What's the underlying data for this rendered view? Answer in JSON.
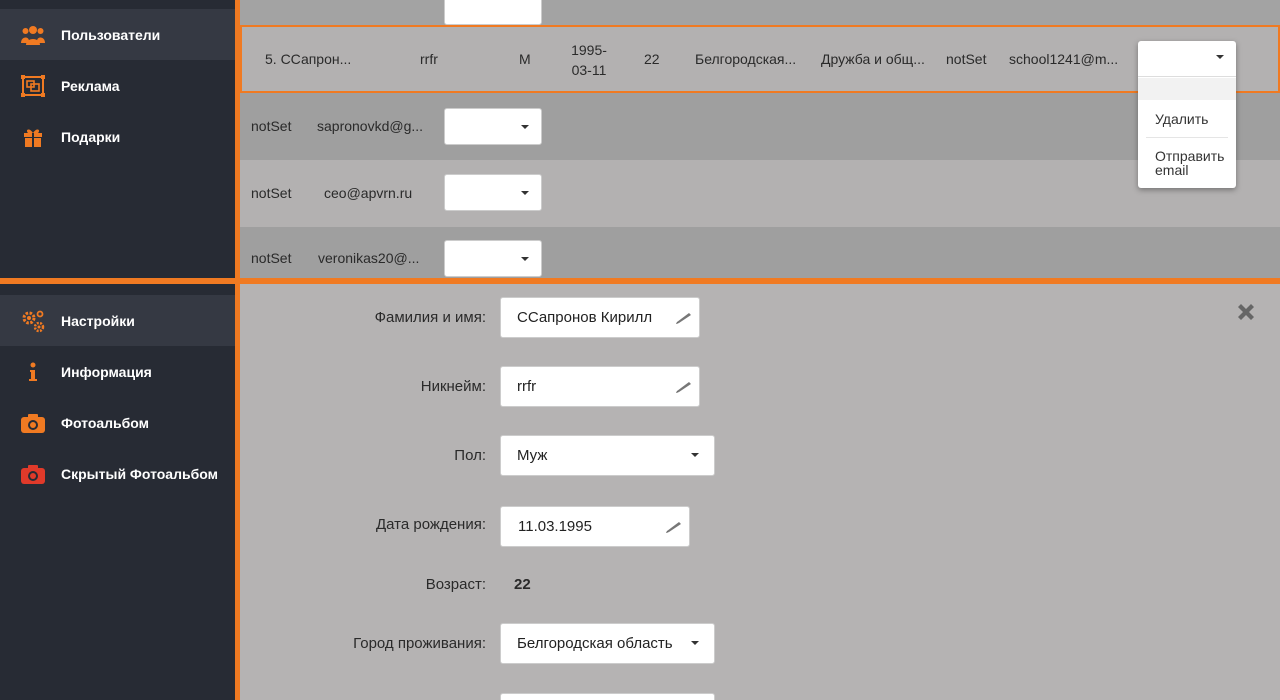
{
  "sidebar_top": {
    "items": [
      {
        "label": "Пользователи",
        "icon": "users-icon"
      },
      {
        "label": "Реклама",
        "icon": "ads-icon"
      },
      {
        "label": "Подарки",
        "icon": "gift-icon"
      }
    ]
  },
  "sidebar_bottom": {
    "items": [
      {
        "label": "Настройки",
        "icon": "gears-icon"
      },
      {
        "label": "Информация",
        "icon": "info-icon"
      },
      {
        "label": "Фотоальбом",
        "icon": "camera-icon"
      },
      {
        "label": "Скрытый Фотоальбом",
        "icon": "hidden-camera-icon"
      }
    ]
  },
  "table": {
    "selected_row": {
      "name": "5. ССапрон...",
      "nickname": "rrfr",
      "sex": "М",
      "birthdate": "1995-03-11",
      "age": "22",
      "city": "Белгородская...",
      "goal": "Дружба и общ...",
      "status": "notSet",
      "email": "school1241@m..."
    },
    "rows": [
      {
        "status": "notSet",
        "email": "sapronovkd@g..."
      },
      {
        "status": "notSet",
        "email": "ceo@apvrn.ru"
      },
      {
        "status": "notSet",
        "email": "veronikas20@..."
      }
    ]
  },
  "dropdown": {
    "options": [
      "Удалить",
      "Отправить email"
    ]
  },
  "form": {
    "name_label": "Фамилия и имя:",
    "name_value": "ССапронов Кирилл",
    "nickname_label": "Никнейм:",
    "nickname_value": "rrfr",
    "sex_label": "Пол:",
    "sex_value": "Муж",
    "birth_label": "Дата рождения:",
    "birth_value": "11.03.1995",
    "age_label": "Возраст:",
    "age_value": "22",
    "city_label": "Город проживания:",
    "city_value": "Белгородская область"
  },
  "colors": {
    "accent": "#f07a22",
    "sidebar": "#272b34",
    "hidden_album_icon": "#e03a2a"
  }
}
